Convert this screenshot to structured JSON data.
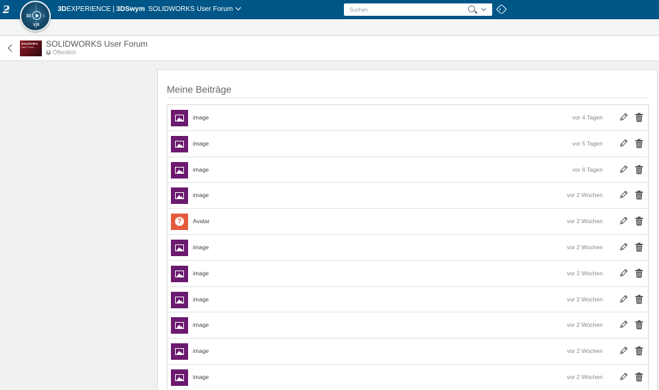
{
  "topbar": {
    "brand_strong": "3D",
    "brand_light": "EXPERIENCE",
    "separator": " | ",
    "app_name": "3DSwym",
    "context": "SOLIDWORKS User Forum",
    "search_placeholder": "Suchen",
    "compass_labels": {
      "top": "",
      "left": "3D",
      "right": "i",
      "bottom": "V,R"
    }
  },
  "header": {
    "community_name": "SOLIDWORKS User Forum",
    "visibility": "Öffentlich",
    "thumb_line1": "SOLIDWORKS",
    "thumb_line2": "User Forum"
  },
  "main": {
    "title": "Meine Beiträge",
    "items": [
      {
        "type": "image",
        "label": "image",
        "time": "vor 4 Tagen"
      },
      {
        "type": "image",
        "label": "image",
        "time": "vor 5 Tagen"
      },
      {
        "type": "image",
        "label": "image",
        "time": "vor 6 Tagen"
      },
      {
        "type": "image",
        "label": "image",
        "time": "vor 2 Wochen"
      },
      {
        "type": "avatar",
        "label": "Avatar",
        "time": "vor 2 Wochen"
      },
      {
        "type": "image",
        "label": "image",
        "time": "vor 2 Wochen"
      },
      {
        "type": "image",
        "label": "image",
        "time": "vor 2 Wochen"
      },
      {
        "type": "image",
        "label": "image",
        "time": "vor 2 Wochen"
      },
      {
        "type": "image",
        "label": "image",
        "time": "vor 2 Wochen"
      },
      {
        "type": "image",
        "label": "image",
        "time": "vor 2 Wochen"
      },
      {
        "type": "image",
        "label": "image",
        "time": "vor 2 Wochen"
      }
    ]
  },
  "colors": {
    "topbar": "#005686",
    "image_thumb": "#6b1a6f",
    "avatar_thumb": "#e55a3d"
  },
  "icons": {
    "logo": "ds-logo-icon",
    "compass": "compass-icon",
    "search": "search-icon",
    "dropdown": "chevron-down-icon",
    "tag": "tag-icon",
    "back": "chevron-left-icon",
    "globe": "globe-icon",
    "edit": "pencil-icon",
    "delete": "trash-icon",
    "image": "image-icon",
    "avatar": "question-icon"
  }
}
